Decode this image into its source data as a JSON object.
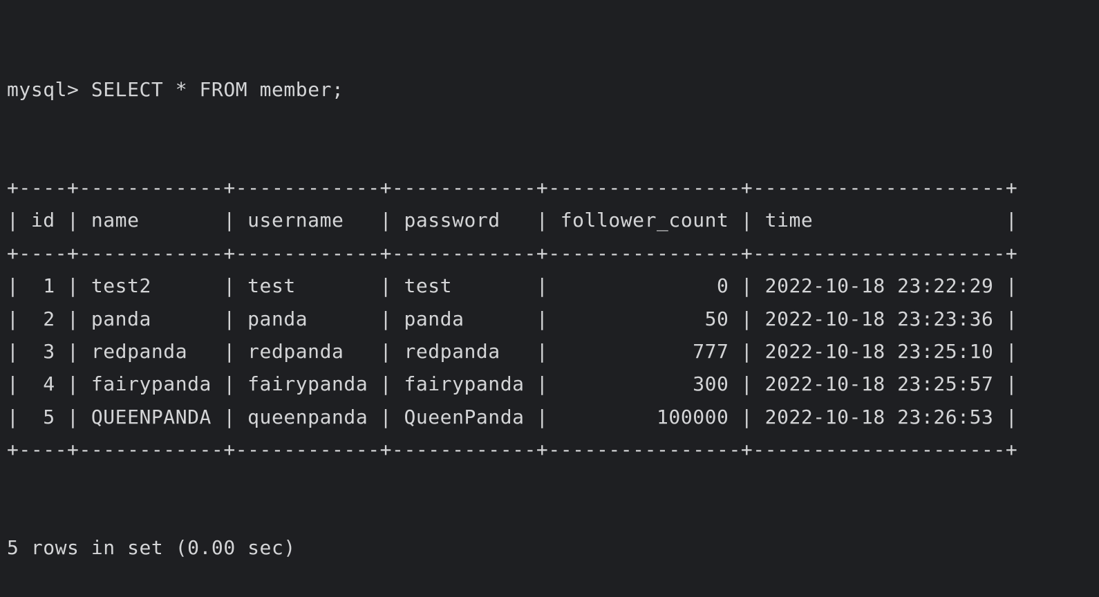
{
  "terminal": {
    "prompt": "mysql> ",
    "command": "SELECT * FROM member;",
    "table": {
      "columns": [
        "id",
        "name",
        "username",
        "password",
        "follower_count",
        "time"
      ],
      "rows": [
        [
          1,
          "test2",
          "test",
          "test",
          0,
          "2022-10-18 23:22:29"
        ],
        [
          2,
          "panda",
          "panda",
          "panda",
          50,
          "2022-10-18 23:23:36"
        ],
        [
          3,
          "redpanda",
          "redpanda",
          "redpanda",
          777,
          "2022-10-18 23:25:10"
        ],
        [
          4,
          "fairypanda",
          "fairypanda",
          "fairypanda",
          300,
          "2022-10-18 23:25:57"
        ],
        [
          5,
          "QUEENPANDA",
          "queenpanda",
          "QueenPanda",
          100000,
          "2022-10-18 23:26:53"
        ]
      ],
      "numeric_columns": [
        "id",
        "follower_count"
      ]
    },
    "result_summary": "5 rows in set (0.00 sec)",
    "colors": {
      "background": "#1e1f22",
      "text": "#d4d5d7"
    }
  }
}
